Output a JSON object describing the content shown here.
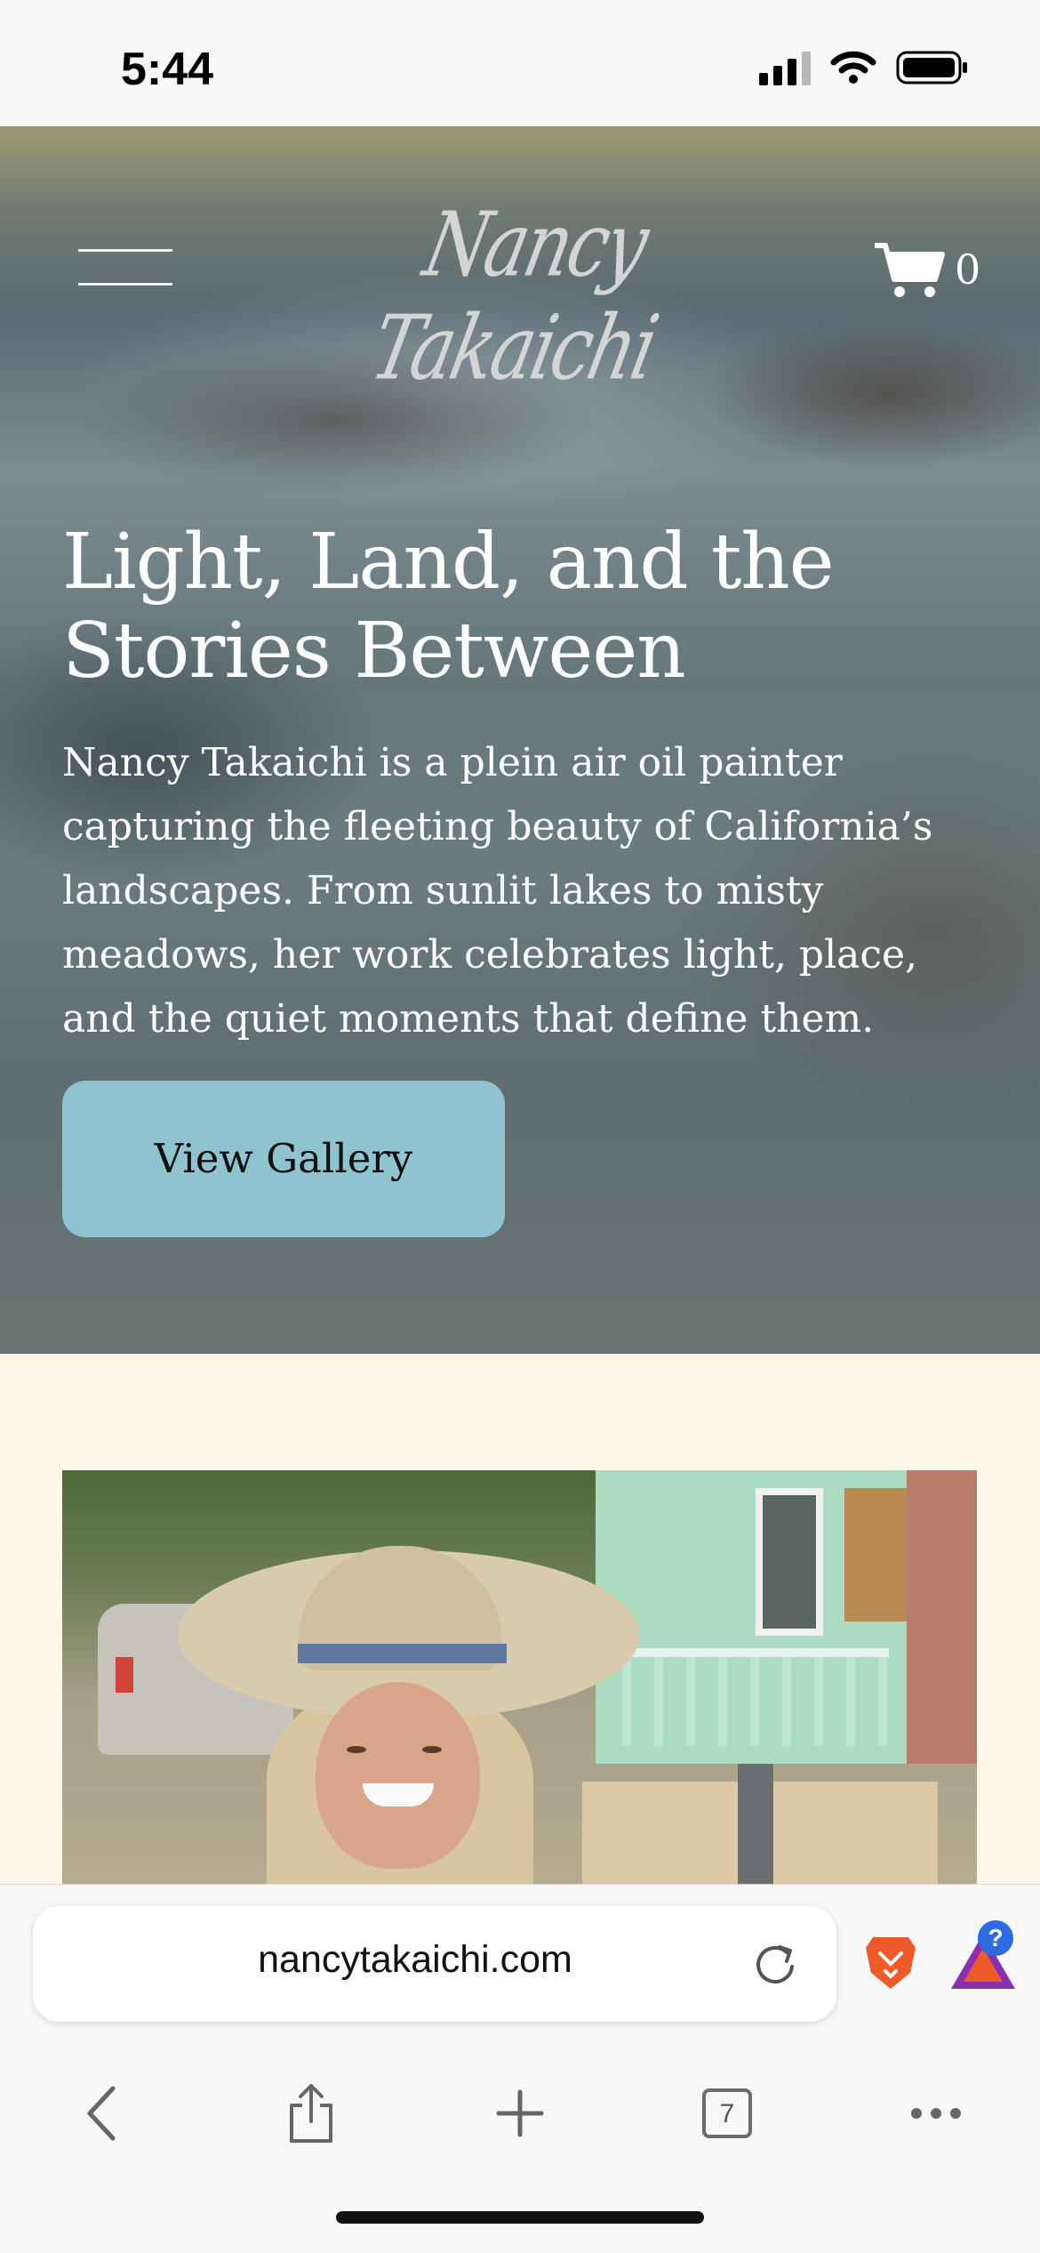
{
  "status_bar": {
    "time": "5:44"
  },
  "header": {
    "logo_text": "Nancy Takaichi",
    "cart_count": "0"
  },
  "hero": {
    "title": "Light, Land, and the Stories Between",
    "description": "Nancy Takaichi is a plein air oil painter capturing the fleeting beauty of California’s landscapes. From sunlit lakes to misty meadows, her work celebrates light, place, and the quiet moments that define them.",
    "button_label": "View Gallery"
  },
  "browser": {
    "url": "nancytakaichi.com",
    "tab_count": "7",
    "rewards_badge": "?"
  },
  "colors": {
    "accent_button": "#8fc3cf",
    "page_background": "#fff8e8",
    "brave_orange": "#ef5a2a"
  },
  "icons": [
    "menu-icon",
    "cart-icon",
    "signal-icon",
    "wifi-icon",
    "battery-icon",
    "reload-icon",
    "brave-lion-icon",
    "brave-rewards-icon",
    "back-icon",
    "share-icon",
    "new-tab-icon",
    "tabs-icon",
    "more-icon"
  ]
}
